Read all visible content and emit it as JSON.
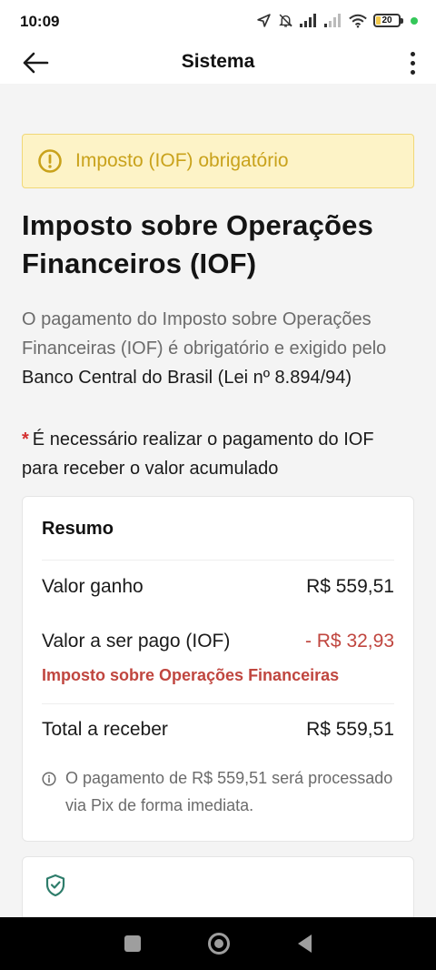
{
  "status_bar": {
    "time": "10:09",
    "battery_level": "20",
    "battery_fraction": 0.2,
    "icons": [
      "location-arrow-icon",
      "mute-bell-icon",
      "signal-icon",
      "signal-weak-icon",
      "wifi-icon",
      "battery-icon",
      "green-dot-indicator"
    ]
  },
  "header": {
    "title": "Sistema",
    "back_icon": "arrow-left-icon",
    "menu_icon": "more-vertical-icon"
  },
  "alert": {
    "icon": "exclamation-circle-icon",
    "text": "Imposto (IOF) obrigatório",
    "color": "#c9a21b",
    "background": "#fdf3c7"
  },
  "page": {
    "title": "Imposto sobre Operações Financeiros (IOF)",
    "description_muted": "O pagamento do Imposto sobre Operações Financeiras (IOF) é obrigatório e exigido pelo",
    "description_dark": "Banco Central do Brasil (Lei nº 8.894/94)",
    "required_star": "*",
    "required_text": "É necessário realizar o pagamento do IOF para receber o valor acumulado"
  },
  "summary": {
    "title": "Resumo",
    "earned_label": "Valor ganho",
    "earned_value": "R$ 559,51",
    "tax_label": "Valor a ser pago (IOF)",
    "tax_value": "- R$ 32,93",
    "tax_note": "Imposto sobre Operações Financeiras",
    "total_label": "Total a receber",
    "total_value": "R$ 559,51",
    "info_text": "O pagamento de R$ 559,51 será processado via Pix de forma imediata.",
    "negative_color": "#c0463f"
  },
  "next_card": {
    "icon": "shield-check-icon"
  },
  "nav_bar": {
    "icons": [
      "recent-apps-icon",
      "home-icon",
      "back-triangle-icon"
    ]
  }
}
